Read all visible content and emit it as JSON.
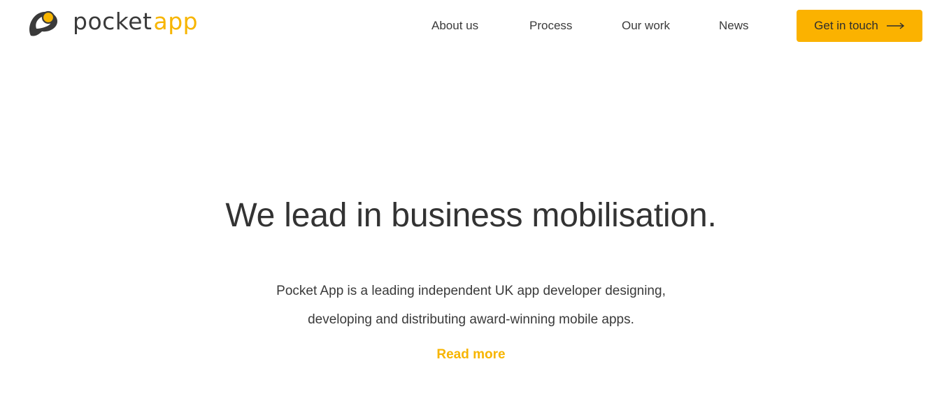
{
  "brand": {
    "name_part1": "pocket",
    "name_part2": "app",
    "accent_color": "#f7b500",
    "dark_color": "#3a3a3a"
  },
  "nav": {
    "items": [
      {
        "label": "About us"
      },
      {
        "label": "Process"
      },
      {
        "label": "Our work"
      },
      {
        "label": "News"
      }
    ],
    "cta": {
      "label": "Get in touch",
      "icon": "arrow-right-icon",
      "color": "#fbb200"
    }
  },
  "hero": {
    "title": "We lead in business mobilisation.",
    "description_line1": "Pocket App is a leading independent UK app developer designing,",
    "description_line2": "developing and distributing award-winning mobile apps.",
    "read_more": "Read more"
  }
}
